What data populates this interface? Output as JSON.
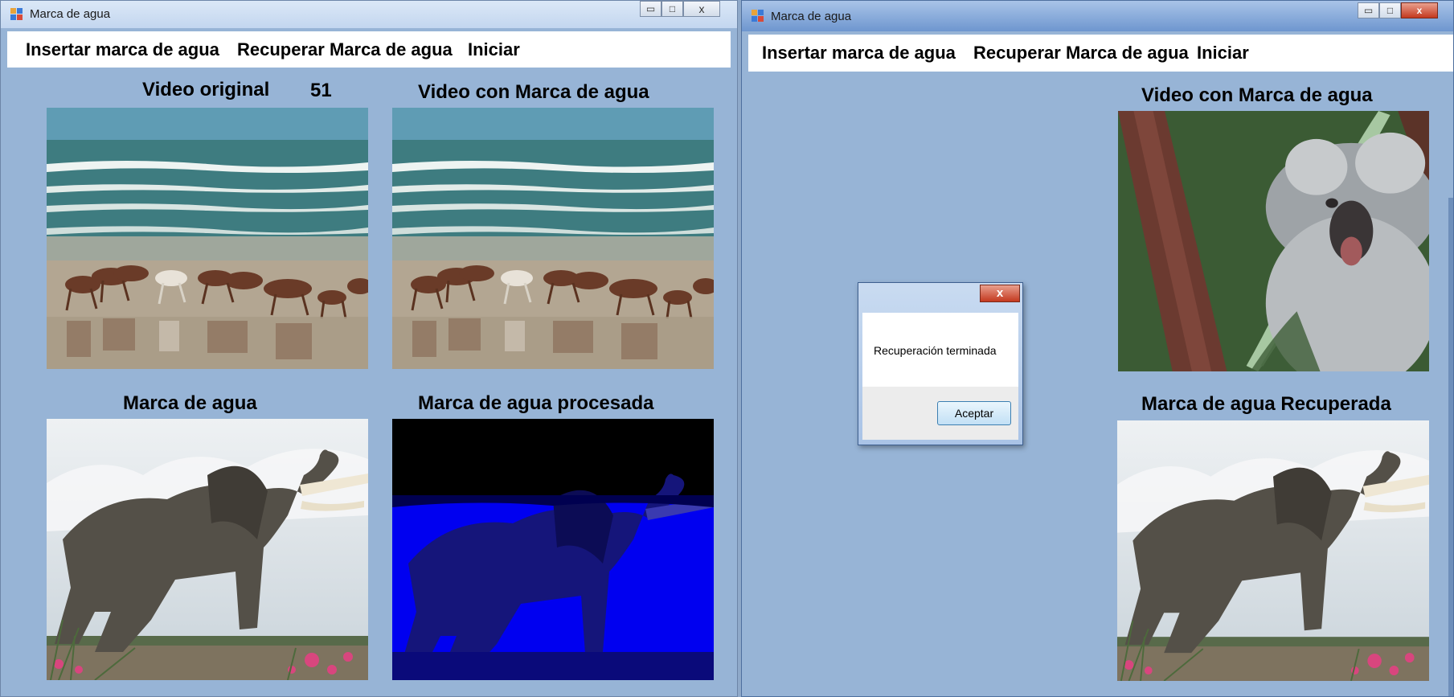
{
  "left_window": {
    "title": "Marca de agua",
    "menu": [
      "Insertar marca de agua",
      "Recuperar Marca de agua",
      "Iniciar"
    ],
    "labels": {
      "original": "Video original",
      "frame_counter": "51",
      "watermarked": "Video con Marca de agua",
      "watermark": "Marca de agua",
      "processed": "Marca de agua procesada"
    }
  },
  "right_window": {
    "title": "Marca de agua",
    "menu": [
      "Insertar marca de agua",
      "Recuperar Marca de agua",
      "Iniciar"
    ],
    "labels": {
      "watermarked": "Video con Marca de agua",
      "recovered": "Marca de agua Recuperada"
    }
  },
  "dialog": {
    "close_glyph": "x",
    "message": "Recuperación terminada",
    "ok_label": "Aceptar"
  },
  "window_controls": {
    "minimize": "▭",
    "maximize": "□",
    "close": "x"
  },
  "icons": {
    "app": "app-icon",
    "beach": "horses-on-beach-image",
    "elephant": "elephant-statue-image",
    "koala": "koala-image"
  },
  "colors": {
    "window_bg": "#97b4d6",
    "menu_bg": "#ffffff",
    "processed_tint": "#0000ff",
    "close_red": "#c4391f"
  }
}
